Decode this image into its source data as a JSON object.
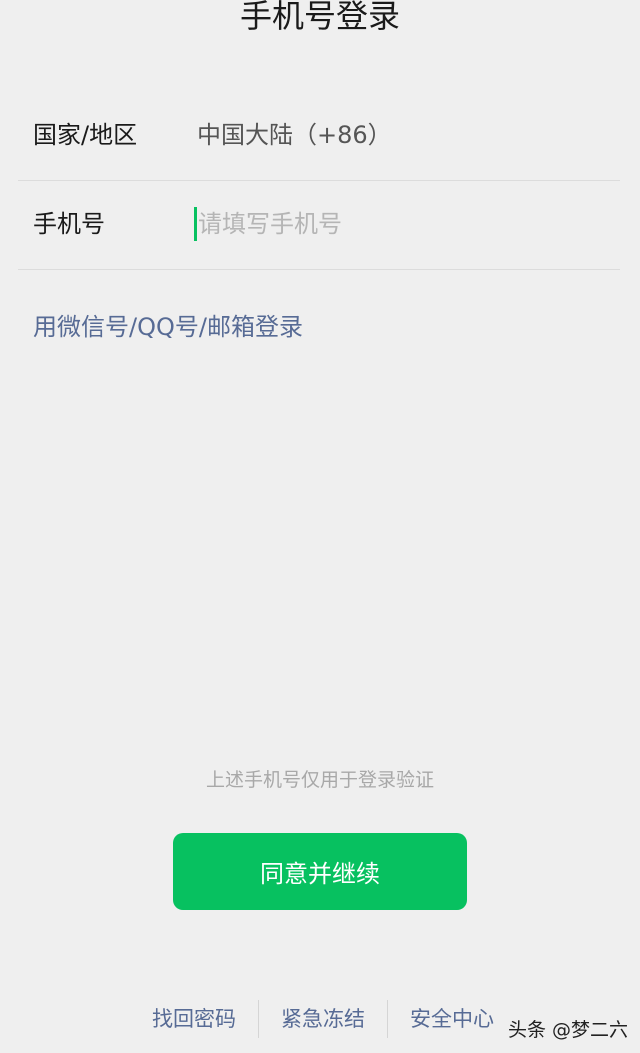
{
  "header": {
    "title": "手机号登录"
  },
  "form": {
    "country": {
      "label": "国家/地区",
      "value": "中国大陆（+86）"
    },
    "phone": {
      "label": "手机号",
      "value": "",
      "placeholder": "请填写手机号"
    }
  },
  "alt_login": {
    "label": "用微信号/QQ号/邮箱登录"
  },
  "notice": {
    "text": "上述手机号仅用于登录验证"
  },
  "submit": {
    "label": "同意并继续",
    "color": "#07c160"
  },
  "footer": {
    "links": [
      {
        "label": "找回密码"
      },
      {
        "label": "紧急冻结"
      },
      {
        "label": "安全中心"
      }
    ]
  },
  "watermark": {
    "text": "头条 @梦二六"
  },
  "colors": {
    "background": "#efefef",
    "link": "#576b95",
    "accent": "#07c160"
  }
}
